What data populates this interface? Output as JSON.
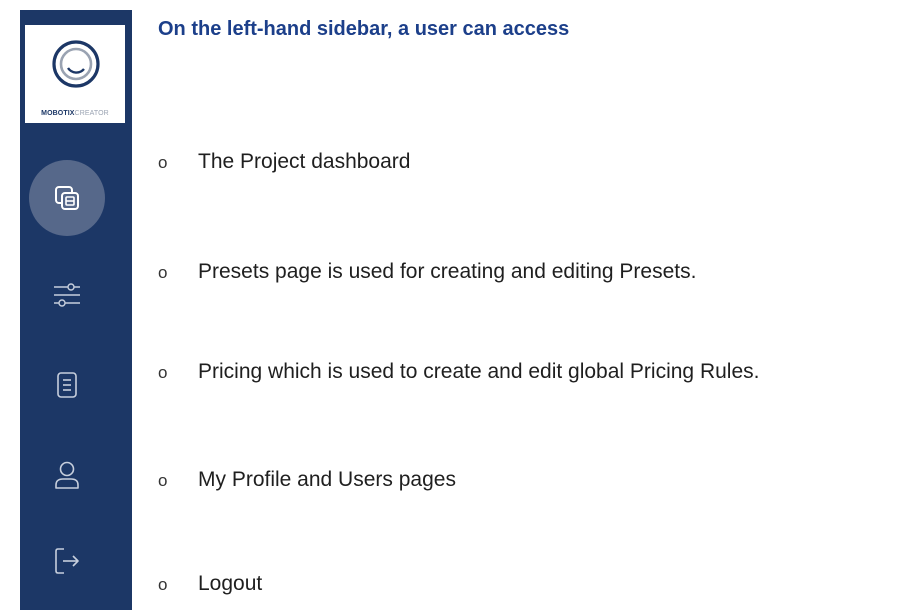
{
  "logo": {
    "brand": "MOBOTIX",
    "sub": "CREATOR",
    "icon": "mobotix-creator-logo"
  },
  "sidebar": {
    "items": [
      {
        "icon": "dashboard-icon",
        "active": true
      },
      {
        "icon": "sliders-icon",
        "active": false
      },
      {
        "icon": "document-icon",
        "active": false
      },
      {
        "icon": "user-icon",
        "active": false
      },
      {
        "icon": "logout-icon",
        "active": false
      }
    ]
  },
  "heading": "On the left-hand sidebar, a user can access",
  "bullets": [
    {
      "marker": "o",
      "text": "The Project dashboard"
    },
    {
      "marker": "o",
      "text": "Presets page is used for creating and editing Presets."
    },
    {
      "marker": "o",
      "text": "Pricing which is used to create and edit global Pricing Rules."
    },
    {
      "marker": "o",
      "text": "My Profile and Users pages"
    },
    {
      "marker": "o",
      "text": "Logout"
    }
  ],
  "colors": {
    "sidebar_bg": "#1c3766",
    "active_bg": "#56688a",
    "heading": "#1c3f8a"
  }
}
